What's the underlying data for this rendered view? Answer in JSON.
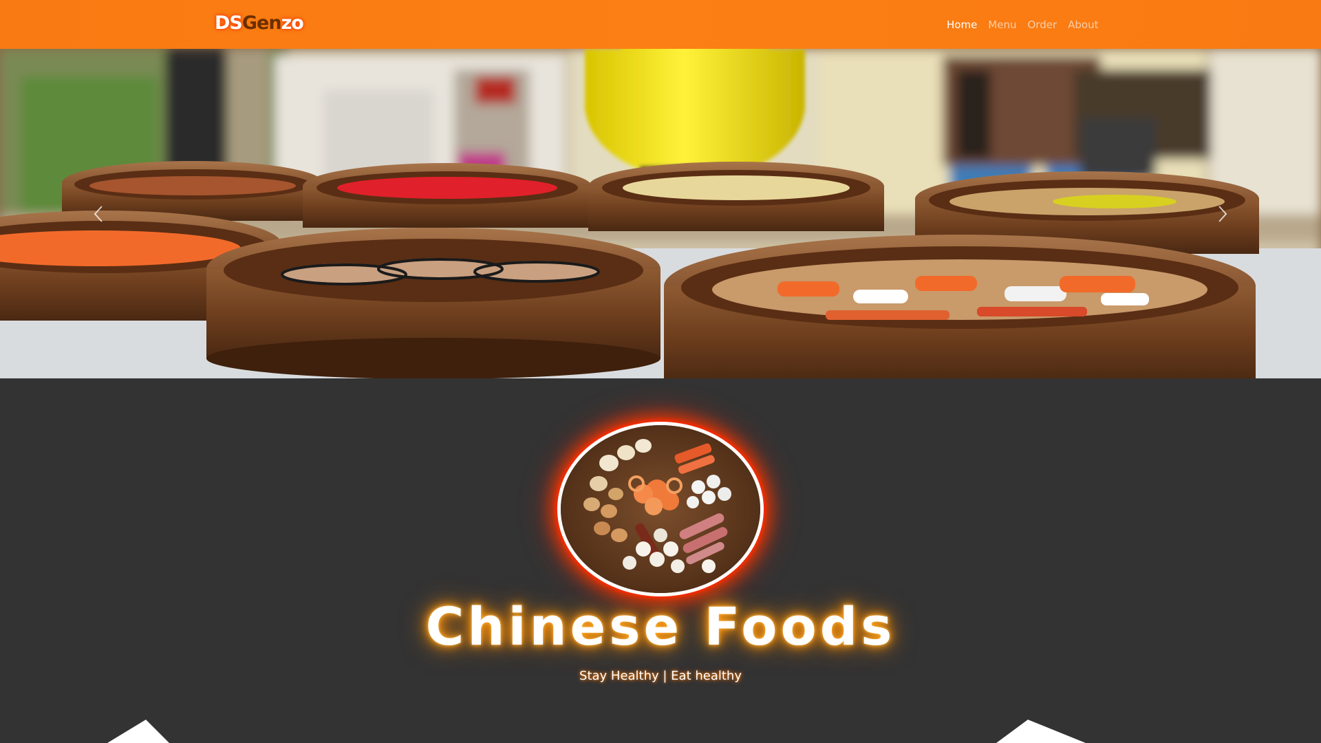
{
  "navbar": {
    "brand": {
      "part1": "DS",
      "part2": "Gen",
      "part3": "zo"
    },
    "links": [
      {
        "label": "Home",
        "active": true
      },
      {
        "label": "Menu",
        "active": false
      },
      {
        "label": "Order",
        "active": false
      },
      {
        "label": "About",
        "active": false
      }
    ],
    "colors": {
      "background": "#fb7f14",
      "active_link": "#ffffff"
    }
  },
  "carousel": {
    "image": "dim-sum-bamboo-steamers-photo",
    "controls": {
      "prev": "chevron-left-icon",
      "next": "chevron-right-icon"
    }
  },
  "hero": {
    "image": "dim-sum-platter-photo",
    "title": "Chinese Foods",
    "subtitle": "Stay Healthy | Eat healthy",
    "colors": {
      "background": "#333333",
      "title_glow": "#ff8c00",
      "plate_glow": "#ff2a00"
    }
  }
}
